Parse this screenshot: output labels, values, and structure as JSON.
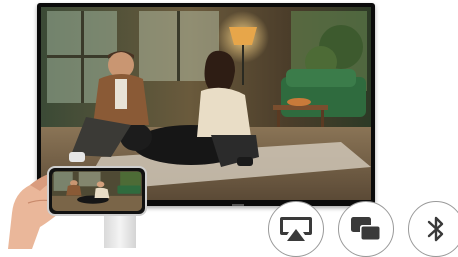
{
  "scene": {
    "tv_screen": "living-room-couple-with-dog",
    "phone_screen": "living-room-couple-with-dog-mirrored"
  },
  "controls": [
    {
      "icon": "airplay-icon",
      "label": ""
    },
    {
      "icon": "screen-mirroring-icon",
      "label": ""
    },
    {
      "icon": "bluetooth-icon",
      "label": ""
    }
  ],
  "colors": {
    "tv_bezel": "#0b0b0b",
    "button_border": "#9a9a9a",
    "icon_fill": "#3a3a3a"
  }
}
